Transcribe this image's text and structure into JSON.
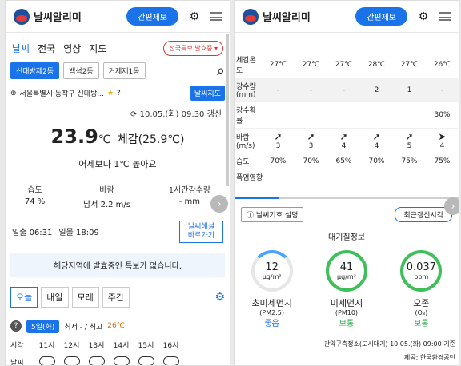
{
  "header": {
    "logo": "날씨알리미",
    "quick": "간편제보"
  },
  "nav": {
    "tabs": [
      "날씨",
      "전국",
      "영상",
      "지도"
    ],
    "alert": "전국특보 발효중 ▾"
  },
  "locations": [
    "신대방제2동",
    "백석2동",
    "거제제1동"
  ],
  "address": "서울특별시 동작구 신대방...",
  "map_btn": "날씨지도",
  "updated": "10.05.(화) 09:30 갱신",
  "current": {
    "temp": "23.9",
    "unit": "℃",
    "feel": "체감(25.9℃)",
    "diff": "어제보다 1℃ 높아요"
  },
  "stats": [
    {
      "label": "습도",
      "value": "74 %"
    },
    {
      "label": "바람",
      "value": "남서 2.2 m/s"
    },
    {
      "label": "1시간강수량",
      "value": "- mm"
    }
  ],
  "sun": {
    "rise": "일출 06:31",
    "set": "일몰 18:09",
    "btn1": "날씨해설",
    "btn2": "바로가기"
  },
  "no_warning": "해당지역에 발효중인 특보가 없습니다.",
  "day_tabs": [
    "오늘",
    "내일",
    "모레",
    "주간"
  ],
  "day": {
    "date": "5일(화)",
    "minmax": "최저 - / 최고",
    "high": "26℃"
  },
  "hours": [
    "시각",
    "11시",
    "12시",
    "13시",
    "14시",
    "15시",
    "16시"
  ],
  "weather_label": "날씨",
  "table": {
    "feel": [
      "체감온도",
      "27℃",
      "27℃",
      "27℃",
      "28℃",
      "27℃",
      "26℃"
    ],
    "rain": [
      "강수량 (mm)",
      "-",
      "-",
      "-",
      "2",
      "1",
      "-"
    ],
    "prob": [
      "강수확률",
      "",
      "",
      "",
      "",
      "",
      "30%"
    ],
    "wind_label": "바람 (m/s)",
    "wind": [
      "3",
      "3",
      "4",
      "4",
      "5",
      "4"
    ],
    "humid": [
      "습도",
      "70%",
      "70%",
      "65%",
      "70%",
      "75%",
      "75%"
    ],
    "heat": "폭염영향"
  },
  "right_bar": {
    "btn1": "날씨기호 설명",
    "btn2": "최근갱신시각"
  },
  "aq_title": "대기질정보",
  "aq": [
    {
      "value": "12",
      "unit": "μg/m³",
      "label": "초미세먼지",
      "sub": "(PM2.5)",
      "grade": "좋음"
    },
    {
      "value": "41",
      "unit": "μg/m³",
      "label": "미세먼지",
      "sub": "(PM10)",
      "grade": "보통"
    },
    {
      "value": "0.037",
      "unit": "ppm",
      "label": "오존",
      "sub": "(O₃)",
      "grade": "보통"
    }
  ],
  "source1": "관악구측정소(도시대기) 10.05.(화) 09:00 기준",
  "source2": "제공: 한국환경공단"
}
